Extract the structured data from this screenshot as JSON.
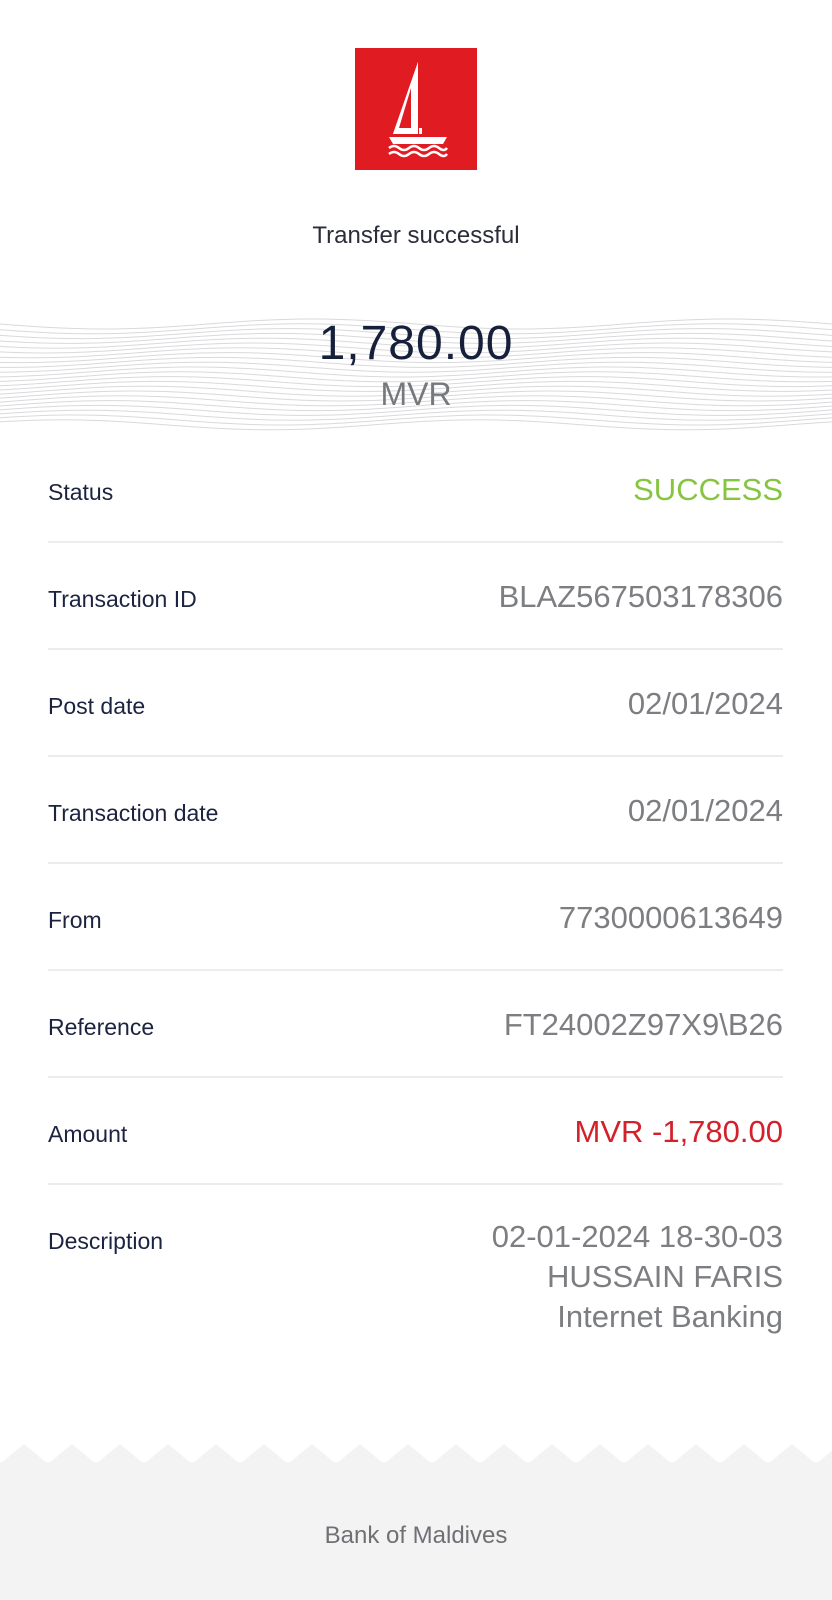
{
  "header": {
    "logo_icon": "bank-sailboat-logo",
    "logo_color": "#e11b22",
    "headline": "Transfer successful"
  },
  "amount": {
    "value": "1,780.00",
    "currency": "MVR"
  },
  "details": [
    {
      "label": "Status",
      "value": "SUCCESS"
    },
    {
      "label": "Transaction ID",
      "value": "BLAZ567503178306"
    },
    {
      "label": "Post date",
      "value": "02/01/2024"
    },
    {
      "label": "Transaction date",
      "value": "02/01/2024"
    },
    {
      "label": "From",
      "value": "7730000613649"
    },
    {
      "label": "Reference",
      "value": "FT24002Z97X9\\B26"
    },
    {
      "label": "Amount",
      "value": "MVR -1,780.00"
    }
  ],
  "description": {
    "label": "Description",
    "lines": [
      "02-01-2024 18-30-03",
      "HUSSAIN FARIS",
      "Internet Banking"
    ]
  },
  "colors": {
    "success": "#86c540",
    "negative": "#d4202a"
  },
  "footer": {
    "bank_name": "Bank of Maldives"
  }
}
